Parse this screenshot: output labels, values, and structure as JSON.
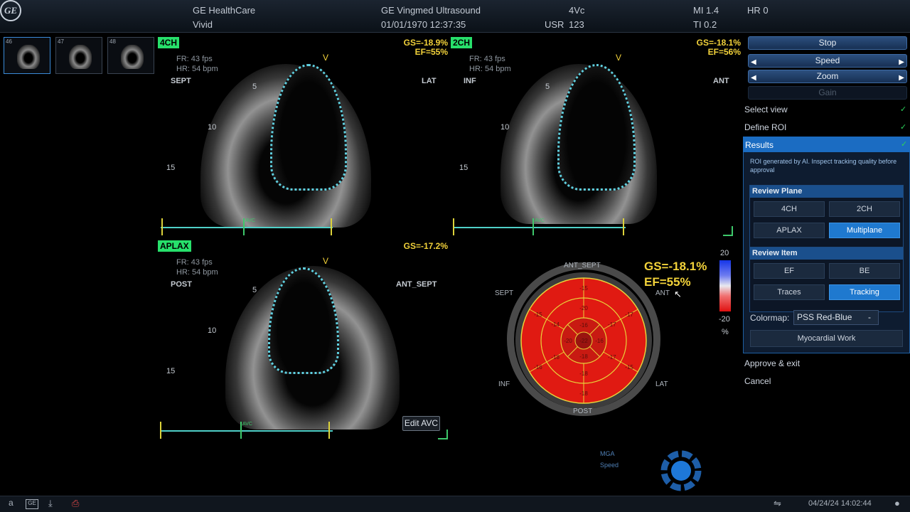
{
  "header": {
    "brand": "GE HealthCare",
    "model": "Vivid",
    "logo_text": "GE",
    "system": "GE Vingmed Ultrasound",
    "datetime": "01/01/1970 12:37:35",
    "probe": "4Vc",
    "user_label": "USR",
    "user_value": "123",
    "mi": "MI 1.4",
    "ti": "TI 0.2",
    "hr": "HR 0"
  },
  "thumbnails": [
    {
      "num": "46"
    },
    {
      "num": "47"
    },
    {
      "num": "48"
    }
  ],
  "views": {
    "four_ch": {
      "tag": "4CH",
      "fr": "FR: 43 fps",
      "hr": "HR: 54 bpm",
      "left": "SEPT",
      "right": "LAT",
      "gs": "GS=-18.9%",
      "ef": "EF=55%",
      "v": "V"
    },
    "two_ch": {
      "tag": "2CH",
      "fr": "FR: 43 fps",
      "hr": "HR: 54 bpm",
      "left": "INF",
      "right": "ANT",
      "gs": "GS=-18.1%",
      "ef": "EF=56%",
      "v": "V"
    },
    "aplax": {
      "tag": "APLAX",
      "fr": "FR: 43 fps",
      "hr": "HR: 54 bpm",
      "left": "POST",
      "right": "ANT_SEPT",
      "gs": "GS=-17.2%",
      "v": "V"
    }
  },
  "depths": [
    "5",
    "10",
    "15"
  ],
  "ecg_avc_label": "AVC",
  "edit_avc": "Edit AVC",
  "bullseye": {
    "gs": "GS=-18.1%",
    "ef": "EF=55%",
    "labels": {
      "top": "ANT_SEPT",
      "left": "SEPT",
      "right": "ANT",
      "bl": "INF",
      "br": "LAT",
      "bottom": "POST"
    },
    "values_outer": [
      "-15",
      "-17",
      "-15",
      "-18",
      "-16",
      "-15"
    ],
    "values_mid": [
      "-20",
      "-17",
      "-17",
      "-18",
      "-18",
      "-14"
    ],
    "values_inner": [
      "-16",
      "-16",
      "-18",
      "-20"
    ],
    "apex": "-22",
    "fill": "#e01a12",
    "lines": "#e8d23a"
  },
  "colorbar": {
    "max": "20",
    "min": "-20",
    "unit": "%"
  },
  "mga": {
    "label1": "MGA",
    "label2": "Speed"
  },
  "right_panel": {
    "stop": "Stop",
    "speed": "Speed",
    "zoom": "Zoom",
    "gain": "Gain",
    "menu": {
      "select_view": "Select view",
      "define_roi": "Define ROI",
      "results": "Results",
      "approve": "Approve & exit",
      "cancel": "Cancel"
    },
    "notice": "ROI generated by AI. Inspect tracking quality before approval",
    "review_plane": {
      "title": "Review Plane",
      "buttons": [
        "4CH",
        "2CH",
        "APLAX",
        "Multiplane"
      ],
      "active": "Multiplane"
    },
    "review_item": {
      "title": "Review Item",
      "buttons": [
        "EF",
        "BE",
        "Traces",
        "Tracking"
      ],
      "active": "Tracking"
    },
    "colormap_label": "Colormap:",
    "colormap_value": "PSS Red-Blue",
    "myocardial_work": "Myocardial Work"
  },
  "footer": {
    "key_a": "a",
    "datetime": "04/24/24 14:02:44"
  }
}
